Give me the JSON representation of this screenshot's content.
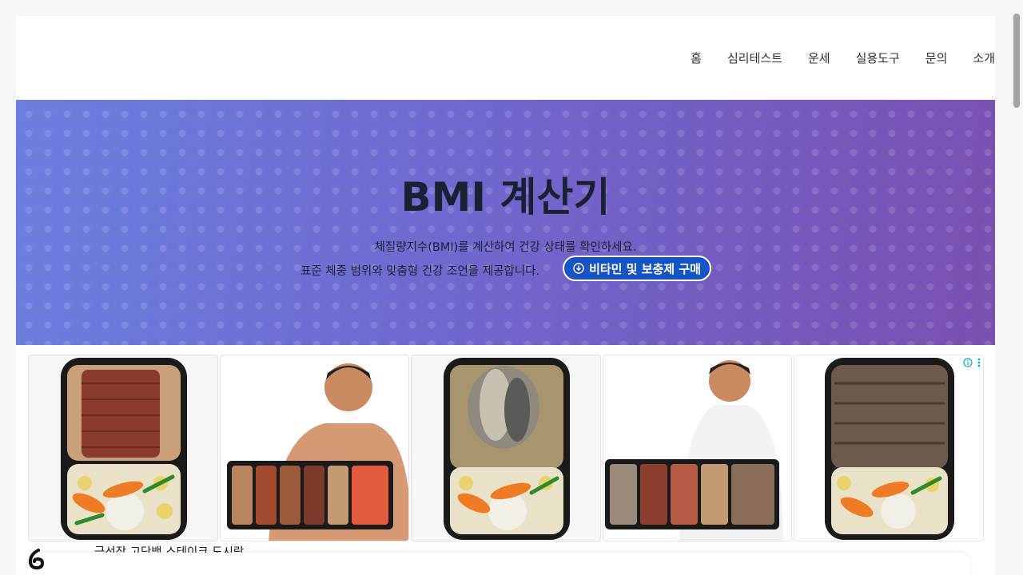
{
  "nav": {
    "items": [
      "홈",
      "심리테스트",
      "운세",
      "실용도구",
      "문의",
      "소개"
    ]
  },
  "hero": {
    "title": "BMI 계산기",
    "subtitle_line1": "체질량지수(BMI)를 계산하여 건강 상태를 확인하세요.",
    "subtitle_line2": "표준 체중 범위와 맞춤형 건강 조언을 제공합니다.",
    "button_label": "비타민 및 보충제 구매",
    "button_icon": "download-circle-icon"
  },
  "ad": {
    "caption": "극선장 고단백 스테이크 도시락",
    "info_icon": "info-icon",
    "menu_icon": "more-vertical-icon"
  },
  "colors": {
    "hero_start": "#6b7fe0",
    "hero_end": "#7a4fb0",
    "button_bg": "#1652c8",
    "title": "#1c2033"
  }
}
